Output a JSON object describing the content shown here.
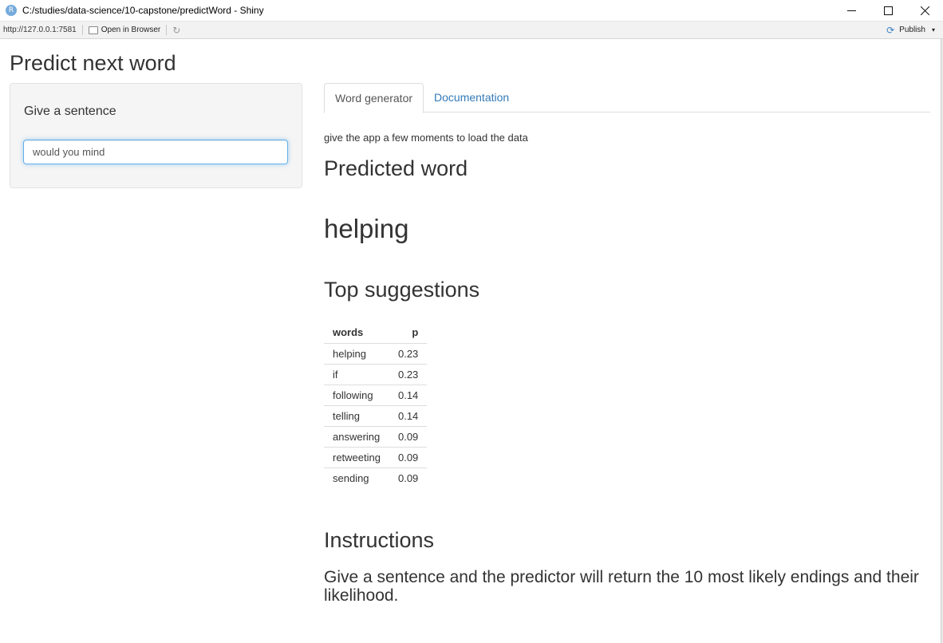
{
  "window": {
    "app_icon_letter": "R",
    "title": "C:/studies/data-science/10-capstone/predictWord - Shiny",
    "minimize_glyph": "—",
    "maximize_glyph": "☐",
    "close_glyph": "✕"
  },
  "toolbar": {
    "url": "http://127.0.0.1:7581",
    "open_in_browser": "Open in Browser",
    "publish": "Publish",
    "publish_caret": "▾"
  },
  "page": {
    "title": "Predict next word"
  },
  "sidebar": {
    "input_label": "Give a sentence",
    "input_value": "would you mind"
  },
  "tabs": [
    {
      "label": "Word generator",
      "active": true
    },
    {
      "label": "Documentation",
      "active": false
    }
  ],
  "main": {
    "note": "give the app a few moments to load the data",
    "predicted_heading": "Predicted word",
    "predicted_word": "helping",
    "top_heading": "Top suggestions",
    "table": {
      "headers": [
        "words",
        "p"
      ],
      "rows": [
        [
          "helping",
          "0.23"
        ],
        [
          "if",
          "0.23"
        ],
        [
          "following",
          "0.14"
        ],
        [
          "telling",
          "0.14"
        ],
        [
          "answering",
          "0.09"
        ],
        [
          "retweeting",
          "0.09"
        ],
        [
          "sending",
          "0.09"
        ]
      ]
    },
    "instructions_heading": "Instructions",
    "instructions_text": "Give a sentence and the predictor will return the 10 most likely endings and their likelihood."
  }
}
